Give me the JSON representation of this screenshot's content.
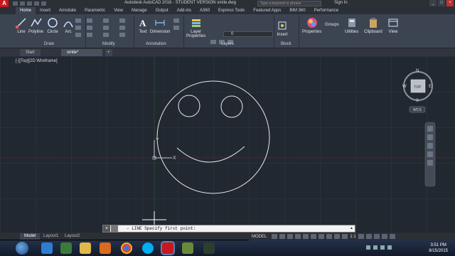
{
  "titlebar": {
    "app_logo": "A",
    "title": "Autodesk AutoCAD 2016 - STUDENT VERSION   smile.dwg",
    "search_placeholder": "Type a keyword or phrase",
    "signin": "Sign In",
    "minimize": "_",
    "maximize": "□",
    "close": "×"
  },
  "ribbon_tabs": [
    "Home",
    "Insert",
    "Annotate",
    "Parametric",
    "View",
    "Manage",
    "Output",
    "Add-ins",
    "A360",
    "Express Tools",
    "Featured Apps",
    "BIM 360",
    "Performance"
  ],
  "active_tab": "Home",
  "ribbon": {
    "draw": {
      "line": "Line",
      "polyline": "Polyline",
      "circle": "Circle",
      "arc": "Arc",
      "label": "Draw"
    },
    "modify": {
      "label": "Modify"
    },
    "annotation": {
      "text": "Text",
      "dimension": "Dimension",
      "label": "Annotation"
    },
    "layers": {
      "layer_properties_1": "Layer",
      "layer_properties_2": "Properties",
      "current_layer": "0",
      "label": "Layers"
    },
    "block": {
      "insert": "Insert",
      "label": "Block"
    },
    "properties": "Properties",
    "groups": "Groups",
    "utilities": "Utilities",
    "clipboard": "Clipboard",
    "view": "View"
  },
  "file_tabs": {
    "start": "Start",
    "file": "smile*",
    "add": "+"
  },
  "viewport": {
    "label": "[-][Top][2D Wireframe]",
    "viewcube": {
      "n": "N",
      "s": "S",
      "e": "E",
      "w": "W",
      "face": "TOP",
      "wcs": "WCS"
    },
    "ucs_x": "X",
    "ucs_y": "Y"
  },
  "layout_tabs": [
    "Model",
    "Layout1",
    "Layout2"
  ],
  "active_layout": "Model",
  "command": {
    "close": "×",
    "prompt": "- LINE Specify first point:"
  },
  "statusbar": {
    "mode": "MODEL",
    "scale": "1:1"
  },
  "clock": {
    "time": "3:51 PM",
    "date": "8/15/2015"
  }
}
